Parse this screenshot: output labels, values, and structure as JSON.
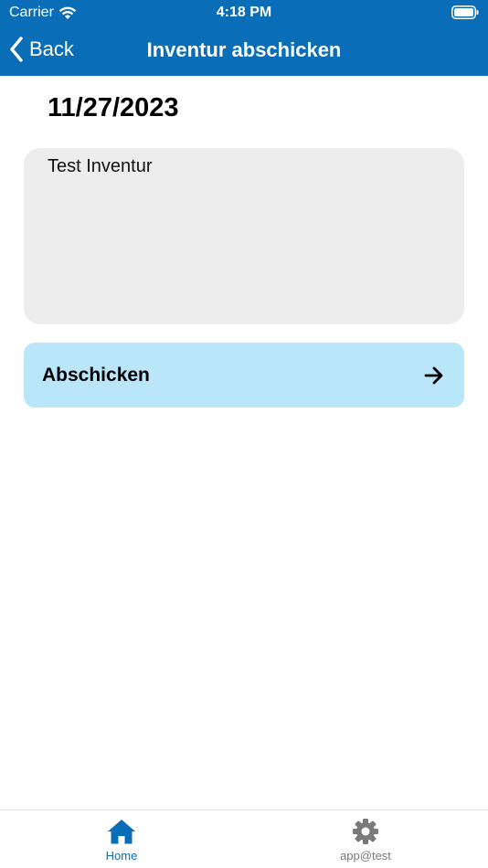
{
  "status_bar": {
    "carrier": "Carrier",
    "time": "4:18 PM"
  },
  "nav": {
    "back_label": "Back",
    "title": "Inventur abschicken"
  },
  "main": {
    "date": "11/27/2023",
    "note": "Test Inventur",
    "submit_label": "Abschicken"
  },
  "tabs": [
    {
      "label": "Home",
      "icon": "home-icon",
      "active": true
    },
    {
      "label": "app@test",
      "icon": "gear-icon",
      "active": false
    }
  ],
  "colors": {
    "brand": "#0a6db8",
    "submit_bg": "#b9e6f8",
    "field_bg": "#ededed",
    "tab_inactive": "#7a7a7a"
  }
}
